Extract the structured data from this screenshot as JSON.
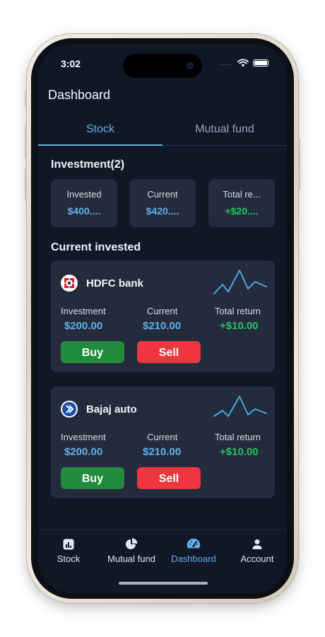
{
  "status_bar": {
    "time": "3:02",
    "signal_dots": "....."
  },
  "header": {
    "title": "Dashboard"
  },
  "tabs": [
    {
      "label": "Stock",
      "active": true
    },
    {
      "label": "Mutual fund",
      "active": false
    }
  ],
  "investment": {
    "title": "Investment(2)",
    "cards": [
      {
        "label": "Invested",
        "value": "$400....",
        "color": "#62b0e8"
      },
      {
        "label": "Current",
        "value": "$420....",
        "color": "#62b0e8"
      },
      {
        "label": "Total re...",
        "value": "+$20....",
        "color": "#22c55e"
      }
    ]
  },
  "current_invested": {
    "title": "Current invested",
    "stocks": [
      {
        "name": "HDFC bank",
        "logo_icon": "hdfc-logo-icon",
        "investment_label": "Investment",
        "investment_value": "$200.00",
        "current_label": "Current",
        "current_value": "$210.00",
        "return_label": "Total return",
        "return_value": "+$10.00",
        "buy_label": "Buy",
        "sell_label": "Sell"
      },
      {
        "name": "Bajaj auto",
        "logo_icon": "bajaj-logo-icon",
        "investment_label": "Investment",
        "investment_value": "$200.00",
        "current_label": "Current",
        "current_value": "$210.00",
        "return_label": "Total return",
        "return_value": "+$10.00",
        "buy_label": "Buy",
        "sell_label": "Sell"
      }
    ]
  },
  "bottom_nav": [
    {
      "label": "Stock",
      "icon": "chart-icon",
      "active": false
    },
    {
      "label": "Mutual fund",
      "icon": "pie-chart-icon",
      "active": false
    },
    {
      "label": "Dashboard",
      "icon": "speedometer-icon",
      "active": true
    },
    {
      "label": "Account",
      "icon": "user-icon",
      "active": false
    }
  ],
  "colors": {
    "background": "#101726",
    "card": "#232b3d",
    "accent": "#62b0e8",
    "positive": "#22c55e",
    "buy": "#238b3d",
    "sell": "#f0363f"
  }
}
